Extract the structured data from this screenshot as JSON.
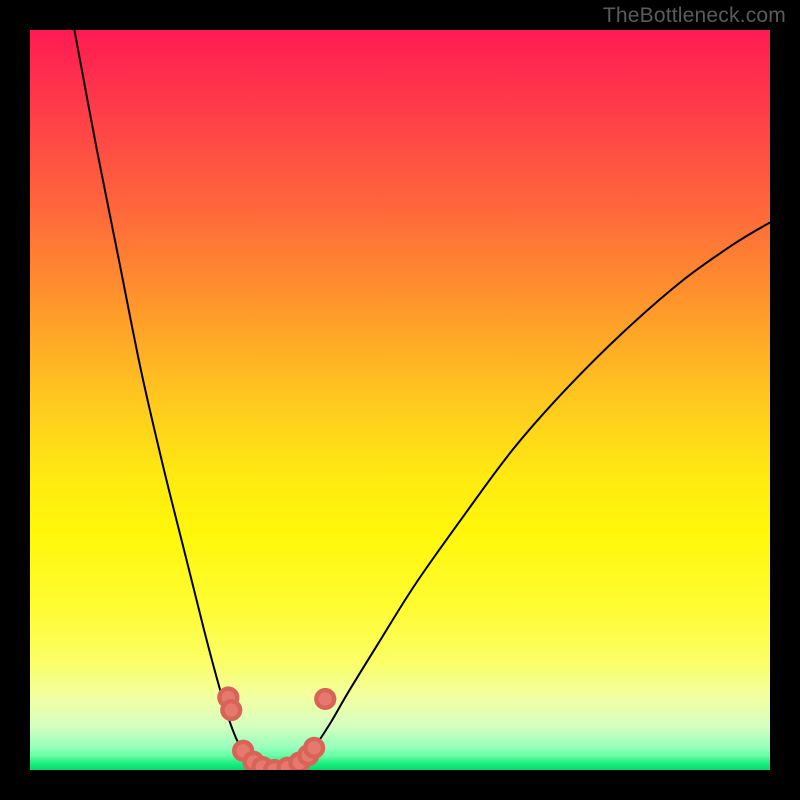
{
  "watermark": "TheBottleneck.com",
  "chart_data": {
    "type": "line",
    "title": "",
    "xlabel": "",
    "ylabel": "",
    "x_domain": [
      0,
      100
    ],
    "y_domain": [
      0,
      100
    ],
    "background_gradient": {
      "orientation": "vertical",
      "stops": [
        {
          "pct": 0,
          "color": "#ff1a52"
        },
        {
          "pct": 25,
          "color": "#ff6a3a"
        },
        {
          "pct": 50,
          "color": "#ffc81f"
        },
        {
          "pct": 70,
          "color": "#fff70a"
        },
        {
          "pct": 90,
          "color": "#f3ffa0"
        },
        {
          "pct": 100,
          "color": "#11e876"
        }
      ]
    },
    "series": [
      {
        "name": "curve",
        "stroke": "#000000",
        "points": [
          {
            "x": 6.0,
            "y": 100.0
          },
          {
            "x": 9.0,
            "y": 84.0
          },
          {
            "x": 12.0,
            "y": 69.0
          },
          {
            "x": 15.0,
            "y": 54.0
          },
          {
            "x": 18.0,
            "y": 41.0
          },
          {
            "x": 21.0,
            "y": 29.0
          },
          {
            "x": 23.5,
            "y": 19.0
          },
          {
            "x": 25.5,
            "y": 11.5
          },
          {
            "x": 27.0,
            "y": 6.5
          },
          {
            "x": 28.5,
            "y": 3.0
          },
          {
            "x": 30.5,
            "y": 0.7
          },
          {
            "x": 33.0,
            "y": 0.0
          },
          {
            "x": 36.0,
            "y": 0.6
          },
          {
            "x": 38.0,
            "y": 2.5
          },
          {
            "x": 40.5,
            "y": 6.2
          },
          {
            "x": 43.0,
            "y": 10.5
          },
          {
            "x": 47.0,
            "y": 17.0
          },
          {
            "x": 52.0,
            "y": 25.0
          },
          {
            "x": 58.0,
            "y": 33.5
          },
          {
            "x": 65.0,
            "y": 43.0
          },
          {
            "x": 72.0,
            "y": 51.0
          },
          {
            "x": 80.0,
            "y": 59.0
          },
          {
            "x": 88.0,
            "y": 66.0
          },
          {
            "x": 95.0,
            "y": 71.0
          },
          {
            "x": 100.0,
            "y": 74.0
          }
        ]
      }
    ],
    "markers": {
      "name": "highlighted-points",
      "color": "#e6786e",
      "radius": 1.2,
      "points": [
        {
          "x": 26.8,
          "y": 9.8
        },
        {
          "x": 27.2,
          "y": 8.1
        },
        {
          "x": 28.8,
          "y": 2.6
        },
        {
          "x": 30.2,
          "y": 1.1
        },
        {
          "x": 31.4,
          "y": 0.4
        },
        {
          "x": 33.0,
          "y": 0.0
        },
        {
          "x": 34.8,
          "y": 0.3
        },
        {
          "x": 36.4,
          "y": 1.0
        },
        {
          "x": 37.6,
          "y": 2.0
        },
        {
          "x": 38.4,
          "y": 3.0
        },
        {
          "x": 39.9,
          "y": 9.6
        }
      ]
    }
  }
}
